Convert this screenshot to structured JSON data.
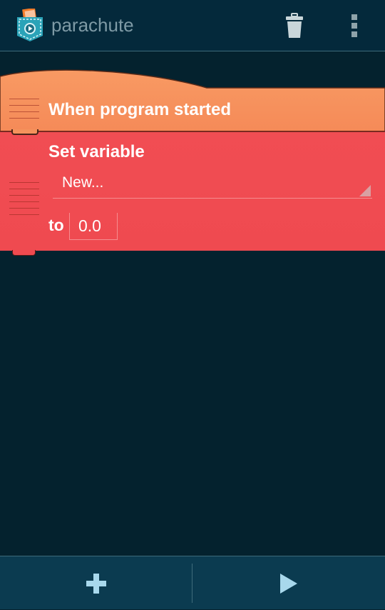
{
  "app_bar": {
    "title": "parachute",
    "logo": "parachute-pocket-logo",
    "trash_icon": "trash-icon",
    "more_icon": "overflow-menu-icon"
  },
  "blocks": {
    "hat": {
      "label": "When program started",
      "color": "#f5925c"
    },
    "set_variable": {
      "label": "Set variable",
      "variable_selected": "New...",
      "to_label": "to",
      "value": "0.0",
      "color": "#ef4a50"
    }
  },
  "bottom_bar": {
    "add_icon": "plus-icon",
    "run_icon": "play-icon"
  }
}
